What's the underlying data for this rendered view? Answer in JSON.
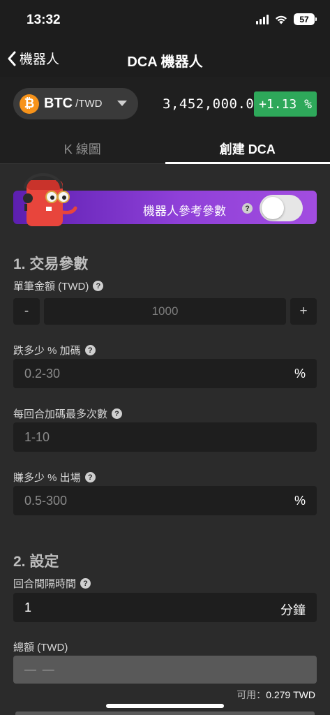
{
  "status_bar": {
    "time": "13:32",
    "battery": "57"
  },
  "nav": {
    "back_label": "機器人",
    "title": "DCA 機器人"
  },
  "ticker": {
    "base": "BTC",
    "quote": "/TWD",
    "coin_symbol": "₿",
    "price": "3,452,000.0",
    "change": "+1.13 %",
    "change_color": "#2ea85a",
    "coin_color": "#f7931a"
  },
  "tabs": [
    {
      "label": "K 線圖",
      "active": false
    },
    {
      "label": "創建 DCA",
      "active": true
    }
  ],
  "banner": {
    "label": "機器人參考參數",
    "toggle_on": false
  },
  "section1": {
    "title": "1. 交易參數",
    "amount": {
      "label": "單筆金額 (TWD)",
      "minus": "-",
      "plus": "+",
      "placeholder": "1000"
    },
    "drop": {
      "label": "跌多少 % 加碼",
      "placeholder": "0.2-30",
      "unit": "%"
    },
    "max_times": {
      "label": "每回合加碼最多次數",
      "placeholder": "1-10"
    },
    "profit": {
      "label": "賺多少 % 出場",
      "placeholder": "0.5-300",
      "unit": "%"
    }
  },
  "section2": {
    "title": "2. 設定",
    "interval": {
      "label": "回合間隔時間",
      "value": "1",
      "unit": "分鐘"
    },
    "total": {
      "label": "總額 (TWD)",
      "placeholder": "— —"
    },
    "available_prefix": "可用：",
    "available_value": "0.279 TWD"
  }
}
